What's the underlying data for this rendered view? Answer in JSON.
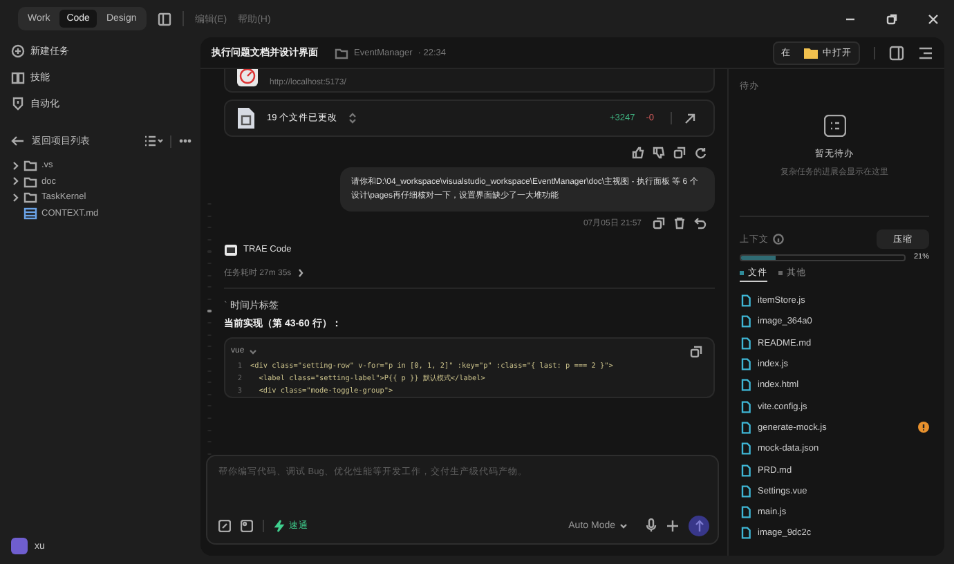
{
  "topbar": {
    "modes": [
      {
        "label": "Work",
        "selected": false
      },
      {
        "label": "Code",
        "selected": true
      },
      {
        "label": "Design",
        "selected": false
      }
    ],
    "menus": [
      "编辑(E)",
      "帮助(H)"
    ]
  },
  "sidebar": {
    "actions": [
      {
        "label": "新建任务",
        "kind": "new"
      },
      {
        "label": "技能",
        "kind": "skills"
      },
      {
        "label": "自动化",
        "kind": "auto"
      }
    ],
    "back": "返回项目列表",
    "tree": [
      {
        "name": ".vs",
        "kind": "folder"
      },
      {
        "name": "doc",
        "kind": "folder"
      },
      {
        "name": "TaskKernel",
        "kind": "folder"
      },
      {
        "name": "CONTEXT.md",
        "kind": "file"
      }
    ],
    "user": "xu"
  },
  "header": {
    "title": "执行问题文档并设计界面",
    "project": "EventManager",
    "time": "· 22:34",
    "open_prefix": "在",
    "open_suffix": "中打开"
  },
  "chat": {
    "preview_url": "http://localhost:5173/",
    "changes": {
      "count": "19 个文件已更改",
      "added": "+3247",
      "removed": "-0"
    },
    "user_message": {
      "text": "请你和D:\\04_workspace\\visualstudio_workspace\\EventManager\\doc\\主视图 - 执行面板 等 6 个设计\\pages再仔细核对一下，设置界面缺少了一大堆功能",
      "date": "07月05日 21:57"
    },
    "assistant": {
      "name": "TRAE Code",
      "duration": "任务耗时 27m 35s",
      "bullet": "`",
      "heading": "时间片标签",
      "subheading": "当前实现（第 43-60 行）：",
      "code": {
        "lang": "vue",
        "lines": [
          {
            "number": "1",
            "text": "<div class=\"setting-row\" v-for=\"p in [0, 1, 2]\" :key=\"p\" :class=\"{ last: p === 2 }\">"
          },
          {
            "number": "2",
            "text": "  <label class=\"setting-label\">P{{ p }} 默认模式</label>"
          },
          {
            "number": "3",
            "text": "  <div class=\"mode-toggle-group\">"
          }
        ]
      }
    }
  },
  "input": {
    "placeholder": "帮你编写代码、调试 Bug、优化性能等开发工作，交付生产级代码产物。",
    "speed": "速通",
    "mode": "Auto Mode"
  },
  "panel": {
    "todo_title": "待办",
    "empty_title": "暂无待办",
    "empty_hint": "复杂任务的进展会显示在这里",
    "context": "上下文",
    "compress": "压缩",
    "level": 0.21,
    "percent": "21%",
    "tabs": [
      {
        "label": "文件",
        "selected": true
      },
      {
        "label": "其他",
        "selected": false
      }
    ],
    "files": [
      {
        "name": "itemStore.js",
        "warning": false
      },
      {
        "name": "image_364a0",
        "warning": false
      },
      {
        "name": "README.md",
        "warning": false
      },
      {
        "name": "index.js",
        "warning": false
      },
      {
        "name": "index.html",
        "warning": false
      },
      {
        "name": "vite.config.js",
        "warning": false
      },
      {
        "name": "generate-mock.js",
        "warning": true
      },
      {
        "name": "mock-data.json",
        "warning": false
      },
      {
        "name": "PRD.md",
        "warning": false
      },
      {
        "name": "Settings.vue",
        "warning": false
      },
      {
        "name": "main.js",
        "warning": false
      },
      {
        "name": "image_9dc2c",
        "warning": false
      }
    ]
  }
}
